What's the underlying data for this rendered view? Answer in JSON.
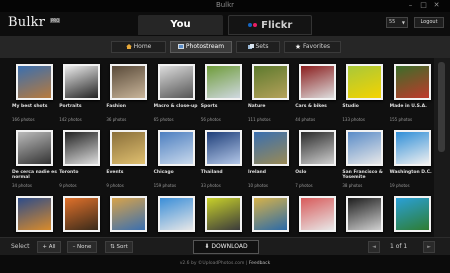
{
  "window": {
    "title": "Bulkr",
    "minimize": "–",
    "maximize": "□",
    "close": "✕"
  },
  "header": {
    "logo": "Bulkr",
    "logo_badge": "PRO",
    "tab_you": "You",
    "tab_flickr": "Flickr",
    "flickr_dot_colors": [
      "#1565c0",
      "#e91e63"
    ],
    "per_page": "55",
    "logout": "Logout"
  },
  "nav": {
    "items": [
      {
        "label": "Home",
        "icon": "home-icon",
        "active": false
      },
      {
        "label": "Photostream",
        "icon": "photostream-icon",
        "active": true
      },
      {
        "label": "Sets",
        "icon": "sets-icon",
        "active": false
      },
      {
        "label": "Favorites",
        "icon": "star-icon",
        "active": false
      }
    ]
  },
  "sets": [
    {
      "name": "My best shots",
      "count": "166 photos",
      "colors": [
        "#3a6fb0",
        "#b87a3c"
      ]
    },
    {
      "name": "Portraits",
      "count": "142 photos",
      "colors": [
        "#ececec",
        "#222"
      ]
    },
    {
      "name": "Fashion",
      "count": "36 photos",
      "colors": [
        "#5a4b3a",
        "#c9b59a"
      ]
    },
    {
      "name": "Macro & close-up",
      "count": "65 photos",
      "colors": [
        "#dcdcdc",
        "#555"
      ]
    },
    {
      "name": "Sports",
      "count": "56 photos",
      "colors": [
        "#6f9c3a",
        "#cfd8e0"
      ]
    },
    {
      "name": "Nature",
      "count": "111 photos",
      "colors": [
        "#5d7a2e",
        "#b5a15a"
      ]
    },
    {
      "name": "Cars & bikes",
      "count": "44 photos",
      "colors": [
        "#8b1e1e",
        "#ddd"
      ]
    },
    {
      "name": "Studio",
      "count": "133 photos",
      "colors": [
        "#a8c83a",
        "#f5d300"
      ]
    },
    {
      "name": "Made in U.S.A.",
      "count": "155 photos",
      "colors": [
        "#3b6e2a",
        "#c0392b"
      ]
    },
    {
      "name": "De cerca nadie es normal",
      "count": "34 photos",
      "colors": [
        "#bbb",
        "#333"
      ]
    },
    {
      "name": "Toronto",
      "count": "9 photos",
      "colors": [
        "#222",
        "#ddd"
      ]
    },
    {
      "name": "Events",
      "count": "9 photos",
      "colors": [
        "#8a6f3a",
        "#e0c070"
      ]
    },
    {
      "name": "Chicago",
      "count": "159 photos",
      "colors": [
        "#4d7fc0",
        "#c9d9ec"
      ]
    },
    {
      "name": "Thailand",
      "count": "33 photos",
      "colors": [
        "#1f3f7a",
        "#b3c7e8"
      ]
    },
    {
      "name": "Ireland",
      "count": "10 photos",
      "colors": [
        "#3a6fb0",
        "#9a8a55"
      ]
    },
    {
      "name": "Oslo",
      "count": "7 photos",
      "colors": [
        "#2b2b2b",
        "#cfcfcf"
      ]
    },
    {
      "name": "San Francisco & Yosemite",
      "count": "38 photos",
      "colors": [
        "#5a8cc8",
        "#e8e8e8"
      ]
    },
    {
      "name": "Washington D.C.",
      "count": "19 photos",
      "colors": [
        "#2f8fd8",
        "#f0f0f0"
      ]
    },
    {
      "name": "",
      "count": "",
      "colors": [
        "#2d4c8a",
        "#d98b2b"
      ]
    },
    {
      "name": "",
      "count": "",
      "colors": [
        "#e0712b",
        "#3a2a1a"
      ]
    },
    {
      "name": "",
      "count": "",
      "colors": [
        "#d8a34a",
        "#3a6fb0"
      ]
    },
    {
      "name": "",
      "count": "",
      "colors": [
        "#3a8ed8",
        "#e7e7e7"
      ]
    },
    {
      "name": "",
      "count": "",
      "colors": [
        "#c8d12a",
        "#3b3b3b"
      ]
    },
    {
      "name": "",
      "count": "",
      "colors": [
        "#d6b24a",
        "#2b6aa8"
      ]
    },
    {
      "name": "",
      "count": "",
      "colors": [
        "#d85a5a",
        "#e8e8e8"
      ]
    },
    {
      "name": "",
      "count": "",
      "colors": [
        "#1d1d1d",
        "#d0d0d0"
      ]
    },
    {
      "name": "",
      "count": "",
      "colors": [
        "#2aa0d8",
        "#2e7d32"
      ]
    }
  ],
  "bottom": {
    "select_label": "Select",
    "all": "+ All",
    "none": "– None",
    "sort": "⇅ Sort",
    "download": "DOWNLOAD",
    "page_info": "1 of 1",
    "prev": "◄",
    "next": "►"
  },
  "footer": {
    "version": "v2.6 by ©UploadPhotos.com",
    "sep": "|",
    "feedback": "Feedback"
  }
}
